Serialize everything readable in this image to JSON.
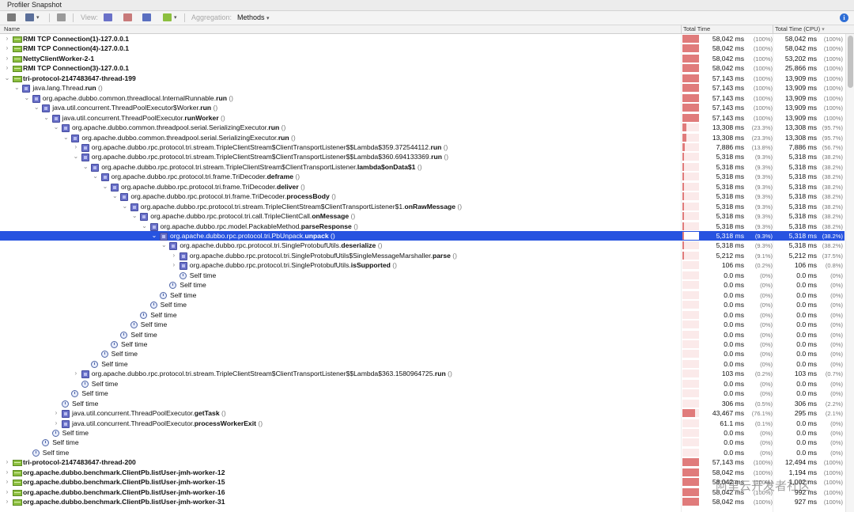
{
  "window": {
    "title": "Profiler Snapshot"
  },
  "toolbar": {
    "view_label": "View:",
    "aggregation_label": "Aggregation:",
    "aggregation_value": "Methods",
    "info_icon_text": "i"
  },
  "columns": {
    "name": "Name",
    "total_time": "Total Time",
    "total_time_cpu": "Total Time (CPU)"
  },
  "colors": {
    "selection": "#2753e0",
    "time_bar": "#e07b7b",
    "thread_icon": "#8cbf3f",
    "method_icon": "#6a71c8"
  },
  "rows": [
    {
      "indent": 0,
      "tw": ">",
      "icon": "thread",
      "pre": "",
      "bold": "RMI TCP Connection(1)-127.0.0.1",
      "post": "",
      "ms": "58,042 ms",
      "pct": "(100%)",
      "cms": "58,042 ms",
      "cpct": "(100%)",
      "bar": 1.0
    },
    {
      "indent": 0,
      "tw": ">",
      "icon": "thread",
      "pre": "",
      "bold": "RMI TCP Connection(4)-127.0.0.1",
      "post": "",
      "ms": "58,042 ms",
      "pct": "(100%)",
      "cms": "58,042 ms",
      "cpct": "(100%)",
      "bar": 1.0
    },
    {
      "indent": 0,
      "tw": ">",
      "icon": "thread",
      "pre": "",
      "bold": "NettyClientWorker-2-1",
      "post": "",
      "ms": "58,042 ms",
      "pct": "(100%)",
      "cms": "53,202 ms",
      "cpct": "(100%)",
      "bar": 1.0
    },
    {
      "indent": 0,
      "tw": ">",
      "icon": "thread",
      "pre": "",
      "bold": "RMI TCP Connection(3)-127.0.0.1",
      "post": "",
      "ms": "58,042 ms",
      "pct": "(100%)",
      "cms": "25,866 ms",
      "cpct": "(100%)",
      "bar": 1.0
    },
    {
      "indent": 0,
      "tw": "v",
      "icon": "thread",
      "pre": "",
      "bold": "tri-protocol-2147483647-thread-199",
      "post": "",
      "ms": "57,143 ms",
      "pct": "(100%)",
      "cms": "13,909 ms",
      "cpct": "(100%)",
      "bar": 1.0
    },
    {
      "indent": 1,
      "tw": "v",
      "icon": "method",
      "pre": "java.lang.Thread.",
      "bold": "run",
      "post": " ()",
      "ms": "57,143 ms",
      "pct": "(100%)",
      "cms": "13,909 ms",
      "cpct": "(100%)",
      "bar": 1.0
    },
    {
      "indent": 2,
      "tw": "v",
      "icon": "method",
      "pre": "org.apache.dubbo.common.threadlocal.InternalRunnable.",
      "bold": "run",
      "post": " ()",
      "ms": "57,143 ms",
      "pct": "(100%)",
      "cms": "13,909 ms",
      "cpct": "(100%)",
      "bar": 1.0
    },
    {
      "indent": 3,
      "tw": "v",
      "icon": "method",
      "pre": "java.util.concurrent.ThreadPoolExecutor$Worker.",
      "bold": "run",
      "post": " ()",
      "ms": "57,143 ms",
      "pct": "(100%)",
      "cms": "13,909 ms",
      "cpct": "(100%)",
      "bar": 1.0
    },
    {
      "indent": 4,
      "tw": "v",
      "icon": "method",
      "pre": "java.util.concurrent.ThreadPoolExecutor.",
      "bold": "runWorker",
      "post": " ()",
      "ms": "57,143 ms",
      "pct": "(100%)",
      "cms": "13,909 ms",
      "cpct": "(100%)",
      "bar": 1.0
    },
    {
      "indent": 5,
      "tw": "v",
      "icon": "method",
      "pre": "org.apache.dubbo.common.threadpool.serial.SerializingExecutor.",
      "bold": "run",
      "post": " ()",
      "ms": "13,308 ms",
      "pct": "(23.3%)",
      "cms": "13,308 ms",
      "cpct": "(95.7%)",
      "bar": 0.233
    },
    {
      "indent": 6,
      "tw": "v",
      "icon": "method",
      "pre": "org.apache.dubbo.common.threadpool.serial.SerializingExecutor.",
      "bold": "run",
      "post": " ()",
      "ms": "13,308 ms",
      "pct": "(23.3%)",
      "cms": "13,308 ms",
      "cpct": "(95.7%)",
      "bar": 0.233
    },
    {
      "indent": 7,
      "tw": ">",
      "icon": "method",
      "pre": "org.apache.dubbo.rpc.protocol.tri.stream.TripleClientStream$ClientTransportListener$$Lambda$359.372544112.",
      "bold": "run",
      "post": " ()",
      "ms": "7,886 ms",
      "pct": "(13.8%)",
      "cms": "7,886 ms",
      "cpct": "(56.7%)",
      "bar": 0.138
    },
    {
      "indent": 7,
      "tw": "v",
      "icon": "method",
      "pre": "org.apache.dubbo.rpc.protocol.tri.stream.TripleClientStream$ClientTransportListener$$Lambda$360.694133369.",
      "bold": "run",
      "post": " ()",
      "ms": "5,318 ms",
      "pct": "(9.3%)",
      "cms": "5,318 ms",
      "cpct": "(38.2%)",
      "bar": 0.093
    },
    {
      "indent": 8,
      "tw": "v",
      "icon": "method",
      "pre": "org.apache.dubbo.rpc.protocol.tri.stream.TripleClientStream$ClientTransportListener.",
      "bold": "lambda$onData$1",
      "post": " ()",
      "ms": "5,318 ms",
      "pct": "(9.3%)",
      "cms": "5,318 ms",
      "cpct": "(38.2%)",
      "bar": 0.093
    },
    {
      "indent": 9,
      "tw": "v",
      "icon": "method",
      "pre": "org.apache.dubbo.rpc.protocol.tri.frame.TriDecoder.",
      "bold": "deframe",
      "post": " ()",
      "ms": "5,318 ms",
      "pct": "(9.3%)",
      "cms": "5,318 ms",
      "cpct": "(38.2%)",
      "bar": 0.093
    },
    {
      "indent": 10,
      "tw": "v",
      "icon": "method",
      "pre": "org.apache.dubbo.rpc.protocol.tri.frame.TriDecoder.",
      "bold": "deliver",
      "post": " ()",
      "ms": "5,318 ms",
      "pct": "(9.3%)",
      "cms": "5,318 ms",
      "cpct": "(38.2%)",
      "bar": 0.093
    },
    {
      "indent": 11,
      "tw": "v",
      "icon": "method",
      "pre": "org.apache.dubbo.rpc.protocol.tri.frame.TriDecoder.",
      "bold": "processBody",
      "post": " ()",
      "ms": "5,318 ms",
      "pct": "(9.3%)",
      "cms": "5,318 ms",
      "cpct": "(38.2%)",
      "bar": 0.093
    },
    {
      "indent": 12,
      "tw": "v",
      "icon": "method",
      "pre": "org.apache.dubbo.rpc.protocol.tri.stream.TripleClientStream$ClientTransportListener$1.",
      "bold": "onRawMessage",
      "post": " ()",
      "ms": "5,318 ms",
      "pct": "(9.3%)",
      "cms": "5,318 ms",
      "cpct": "(38.2%)",
      "bar": 0.093
    },
    {
      "indent": 13,
      "tw": "v",
      "icon": "method",
      "pre": "org.apache.dubbo.rpc.protocol.tri.call.TripleClientCall.",
      "bold": "onMessage",
      "post": " ()",
      "ms": "5,318 ms",
      "pct": "(9.3%)",
      "cms": "5,318 ms",
      "cpct": "(38.2%)",
      "bar": 0.093
    },
    {
      "indent": 14,
      "tw": "v",
      "icon": "method",
      "pre": "org.apache.dubbo.rpc.model.PackableMethod.",
      "bold": "parseResponse",
      "post": " ()",
      "ms": "5,318 ms",
      "pct": "(9.3%)",
      "cms": "5,318 ms",
      "cpct": "(38.2%)",
      "bar": 0.093
    },
    {
      "indent": 15,
      "tw": "v",
      "icon": "method",
      "pre": "org.apache.dubbo.rpc.protocol.tri.PbUnpack.",
      "bold": "unpack",
      "post": " ()",
      "ms": "5,318 ms",
      "pct": "(9.3%)",
      "cms": "5,318 ms",
      "cpct": "(38.2%)",
      "bar": 0.093,
      "selected": true
    },
    {
      "indent": 16,
      "tw": "v",
      "icon": "method",
      "pre": "org.apache.dubbo.rpc.protocol.tri.SingleProtobufUtils.",
      "bold": "deserialize",
      "post": " ()",
      "ms": "5,318 ms",
      "pct": "(9.3%)",
      "cms": "5,318 ms",
      "cpct": "(38.2%)",
      "bar": 0.093
    },
    {
      "indent": 17,
      "tw": ">",
      "icon": "method",
      "pre": "org.apache.dubbo.rpc.protocol.tri.SingleProtobufUtils$SingleMessageMarshaller.",
      "bold": "parse",
      "post": " ()",
      "ms": "5,212 ms",
      "pct": "(9.1%)",
      "cms": "5,212 ms",
      "cpct": "(37.5%)",
      "bar": 0.091
    },
    {
      "indent": 17,
      "tw": ">",
      "icon": "method",
      "pre": "org.apache.dubbo.rpc.protocol.tri.SingleProtobufUtils.",
      "bold": "isSupported",
      "post": " ()",
      "ms": "106 ms",
      "pct": "(0.2%)",
      "cms": "106 ms",
      "cpct": "(0.8%)",
      "bar": 0.0
    },
    {
      "indent": 17,
      "tw": "",
      "icon": "self",
      "pre": "Self time",
      "bold": "",
      "post": "",
      "ms": "0.0 ms",
      "pct": "(0%)",
      "cms": "0.0 ms",
      "cpct": "(0%)",
      "bar": 0.0
    },
    {
      "indent": 16,
      "tw": "",
      "icon": "self",
      "pre": "Self time",
      "bold": "",
      "post": "",
      "ms": "0.0 ms",
      "pct": "(0%)",
      "cms": "0.0 ms",
      "cpct": "(0%)",
      "bar": 0.0
    },
    {
      "indent": 15,
      "tw": "",
      "icon": "self",
      "pre": "Self time",
      "bold": "",
      "post": "",
      "ms": "0.0 ms",
      "pct": "(0%)",
      "cms": "0.0 ms",
      "cpct": "(0%)",
      "bar": 0.0
    },
    {
      "indent": 14,
      "tw": "",
      "icon": "self",
      "pre": "Self time",
      "bold": "",
      "post": "",
      "ms": "0.0 ms",
      "pct": "(0%)",
      "cms": "0.0 ms",
      "cpct": "(0%)",
      "bar": 0.0
    },
    {
      "indent": 13,
      "tw": "",
      "icon": "self",
      "pre": "Self time",
      "bold": "",
      "post": "",
      "ms": "0.0 ms",
      "pct": "(0%)",
      "cms": "0.0 ms",
      "cpct": "(0%)",
      "bar": 0.0
    },
    {
      "indent": 12,
      "tw": "",
      "icon": "self",
      "pre": "Self time",
      "bold": "",
      "post": "",
      "ms": "0.0 ms",
      "pct": "(0%)",
      "cms": "0.0 ms",
      "cpct": "(0%)",
      "bar": 0.0
    },
    {
      "indent": 11,
      "tw": "",
      "icon": "self",
      "pre": "Self time",
      "bold": "",
      "post": "",
      "ms": "0.0 ms",
      "pct": "(0%)",
      "cms": "0.0 ms",
      "cpct": "(0%)",
      "bar": 0.0
    },
    {
      "indent": 10,
      "tw": "",
      "icon": "self",
      "pre": "Self time",
      "bold": "",
      "post": "",
      "ms": "0.0 ms",
      "pct": "(0%)",
      "cms": "0.0 ms",
      "cpct": "(0%)",
      "bar": 0.0
    },
    {
      "indent": 9,
      "tw": "",
      "icon": "self",
      "pre": "Self time",
      "bold": "",
      "post": "",
      "ms": "0.0 ms",
      "pct": "(0%)",
      "cms": "0.0 ms",
      "cpct": "(0%)",
      "bar": 0.0
    },
    {
      "indent": 8,
      "tw": "",
      "icon": "self",
      "pre": "Self time",
      "bold": "",
      "post": "",
      "ms": "0.0 ms",
      "pct": "(0%)",
      "cms": "0.0 ms",
      "cpct": "(0%)",
      "bar": 0.0
    },
    {
      "indent": 7,
      "tw": ">",
      "icon": "method",
      "pre": "org.apache.dubbo.rpc.protocol.tri.stream.TripleClientStream$ClientTransportListener$$Lambda$363.1580964725.",
      "bold": "run",
      "post": " ()",
      "ms": "103 ms",
      "pct": "(0.2%)",
      "cms": "103 ms",
      "cpct": "(0.7%)",
      "bar": 0.0
    },
    {
      "indent": 7,
      "tw": "",
      "icon": "self",
      "pre": "Self time",
      "bold": "",
      "post": "",
      "ms": "0.0 ms",
      "pct": "(0%)",
      "cms": "0.0 ms",
      "cpct": "(0%)",
      "bar": 0.0
    },
    {
      "indent": 6,
      "tw": "",
      "icon": "self",
      "pre": "Self time",
      "bold": "",
      "post": "",
      "ms": "0.0 ms",
      "pct": "(0%)",
      "cms": "0.0 ms",
      "cpct": "(0%)",
      "bar": 0.0
    },
    {
      "indent": 5,
      "tw": "",
      "icon": "self",
      "pre": "Self time",
      "bold": "",
      "post": "",
      "ms": "306 ms",
      "pct": "(0.5%)",
      "cms": "306 ms",
      "cpct": "(2.2%)",
      "bar": 0.0
    },
    {
      "indent": 5,
      "tw": ">",
      "icon": "method",
      "pre": "java.util.concurrent.ThreadPoolExecutor.",
      "bold": "getTask",
      "post": " ()",
      "ms": "43,467 ms",
      "pct": "(76.1%)",
      "cms": "295 ms",
      "cpct": "(2.1%)",
      "bar": 0.761
    },
    {
      "indent": 5,
      "tw": ">",
      "icon": "method",
      "pre": "java.util.concurrent.ThreadPoolExecutor.",
      "bold": "processWorkerExit",
      "post": " ()",
      "ms": "61.1 ms",
      "pct": "(0.1%)",
      "cms": "0.0 ms",
      "cpct": "(0%)",
      "bar": 0.0
    },
    {
      "indent": 4,
      "tw": "",
      "icon": "self",
      "pre": "Self time",
      "bold": "",
      "post": "",
      "ms": "0.0 ms",
      "pct": "(0%)",
      "cms": "0.0 ms",
      "cpct": "(0%)",
      "bar": 0.0
    },
    {
      "indent": 3,
      "tw": "",
      "icon": "self",
      "pre": "Self time",
      "bold": "",
      "post": "",
      "ms": "0.0 ms",
      "pct": "(0%)",
      "cms": "0.0 ms",
      "cpct": "(0%)",
      "bar": 0.0
    },
    {
      "indent": 2,
      "tw": "",
      "icon": "self",
      "pre": "Self time",
      "bold": "",
      "post": "",
      "ms": "0.0 ms",
      "pct": "(0%)",
      "cms": "0.0 ms",
      "cpct": "(0%)",
      "bar": 0.0
    },
    {
      "indent": 0,
      "tw": ">",
      "icon": "thread",
      "pre": "",
      "bold": "tri-protocol-2147483647-thread-200",
      "post": "",
      "ms": "57,143 ms",
      "pct": "(100%)",
      "cms": "12,494 ms",
      "cpct": "(100%)",
      "bar": 1.0
    },
    {
      "indent": 0,
      "tw": ">",
      "icon": "thread",
      "pre": "",
      "bold": "org.apache.dubbo.benchmark.ClientPb.listUser-jmh-worker-12",
      "post": "",
      "ms": "58,042 ms",
      "pct": "(100%)",
      "cms": "1,194 ms",
      "cpct": "(100%)",
      "bar": 1.0
    },
    {
      "indent": 0,
      "tw": ">",
      "icon": "thread",
      "pre": "",
      "bold": "org.apache.dubbo.benchmark.ClientPb.listUser-jmh-worker-15",
      "post": "",
      "ms": "58,042 ms",
      "pct": "(100%)",
      "cms": "1,002 ms",
      "cpct": "(100%)",
      "bar": 1.0
    },
    {
      "indent": 0,
      "tw": ">",
      "icon": "thread",
      "pre": "",
      "bold": "org.apache.dubbo.benchmark.ClientPb.listUser-jmh-worker-16",
      "post": "",
      "ms": "58,042 ms",
      "pct": "(100%)",
      "cms": "992 ms",
      "cpct": "(100%)",
      "bar": 1.0
    },
    {
      "indent": 0,
      "tw": ">",
      "icon": "thread",
      "pre": "",
      "bold": "org.apache.dubbo.benchmark.ClientPb.listUser-jmh-worker-31",
      "post": "",
      "ms": "58,042 ms",
      "pct": "(100%)",
      "cms": "927 ms",
      "cpct": "(100%)",
      "bar": 1.0
    }
  ]
}
